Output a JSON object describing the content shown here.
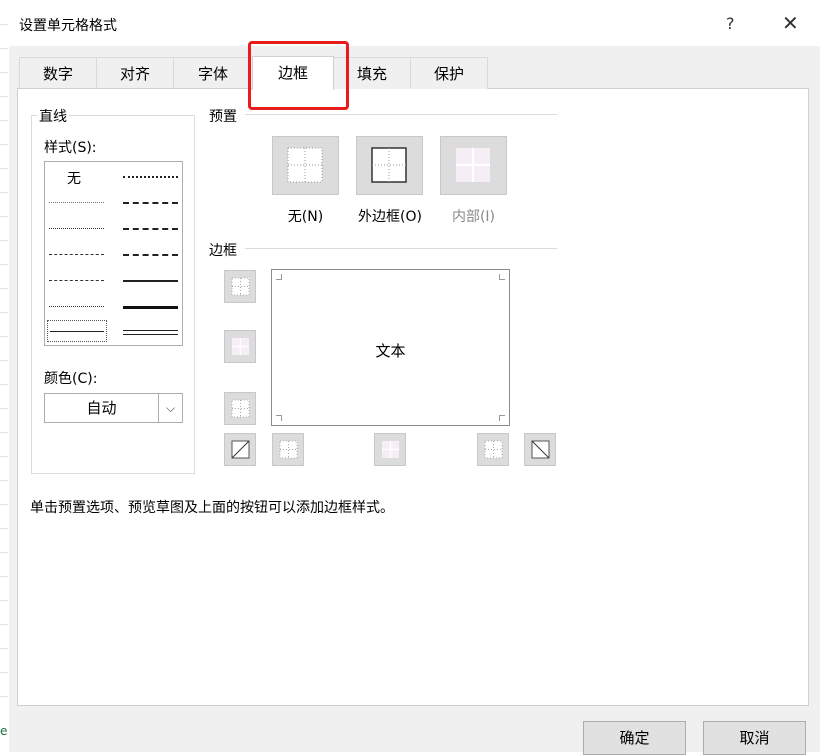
{
  "dialog": {
    "title": "设置单元格格式",
    "help": "?",
    "close": "✕"
  },
  "tabs": [
    {
      "label": "数字"
    },
    {
      "label": "对齐"
    },
    {
      "label": "字体"
    },
    {
      "label": "边框",
      "active": true
    },
    {
      "label": "填充"
    },
    {
      "label": "保护"
    }
  ],
  "line": {
    "group_label": "直线",
    "style_label": "样式(S):",
    "style_none": "无",
    "color_label": "颜色(C):",
    "color_value": "自动"
  },
  "presets": {
    "section_label": "预置",
    "items": [
      {
        "label": "无(N)",
        "enabled": true
      },
      {
        "label": "外边框(O)",
        "enabled": true
      },
      {
        "label": "内部(I)",
        "enabled": false
      }
    ]
  },
  "border": {
    "section_label": "边框",
    "preview_text": "文本"
  },
  "hint": "单击预置选项、预览草图及上面的按钮可以添加边框样式。",
  "footer": {
    "ok": "确定",
    "cancel": "取消"
  },
  "sheet": {
    "edge_text": "e"
  },
  "colors": {
    "highlight": "#e81c1c",
    "panel_bg": "#ffffff",
    "dialog_bg": "#f0f0f0"
  }
}
